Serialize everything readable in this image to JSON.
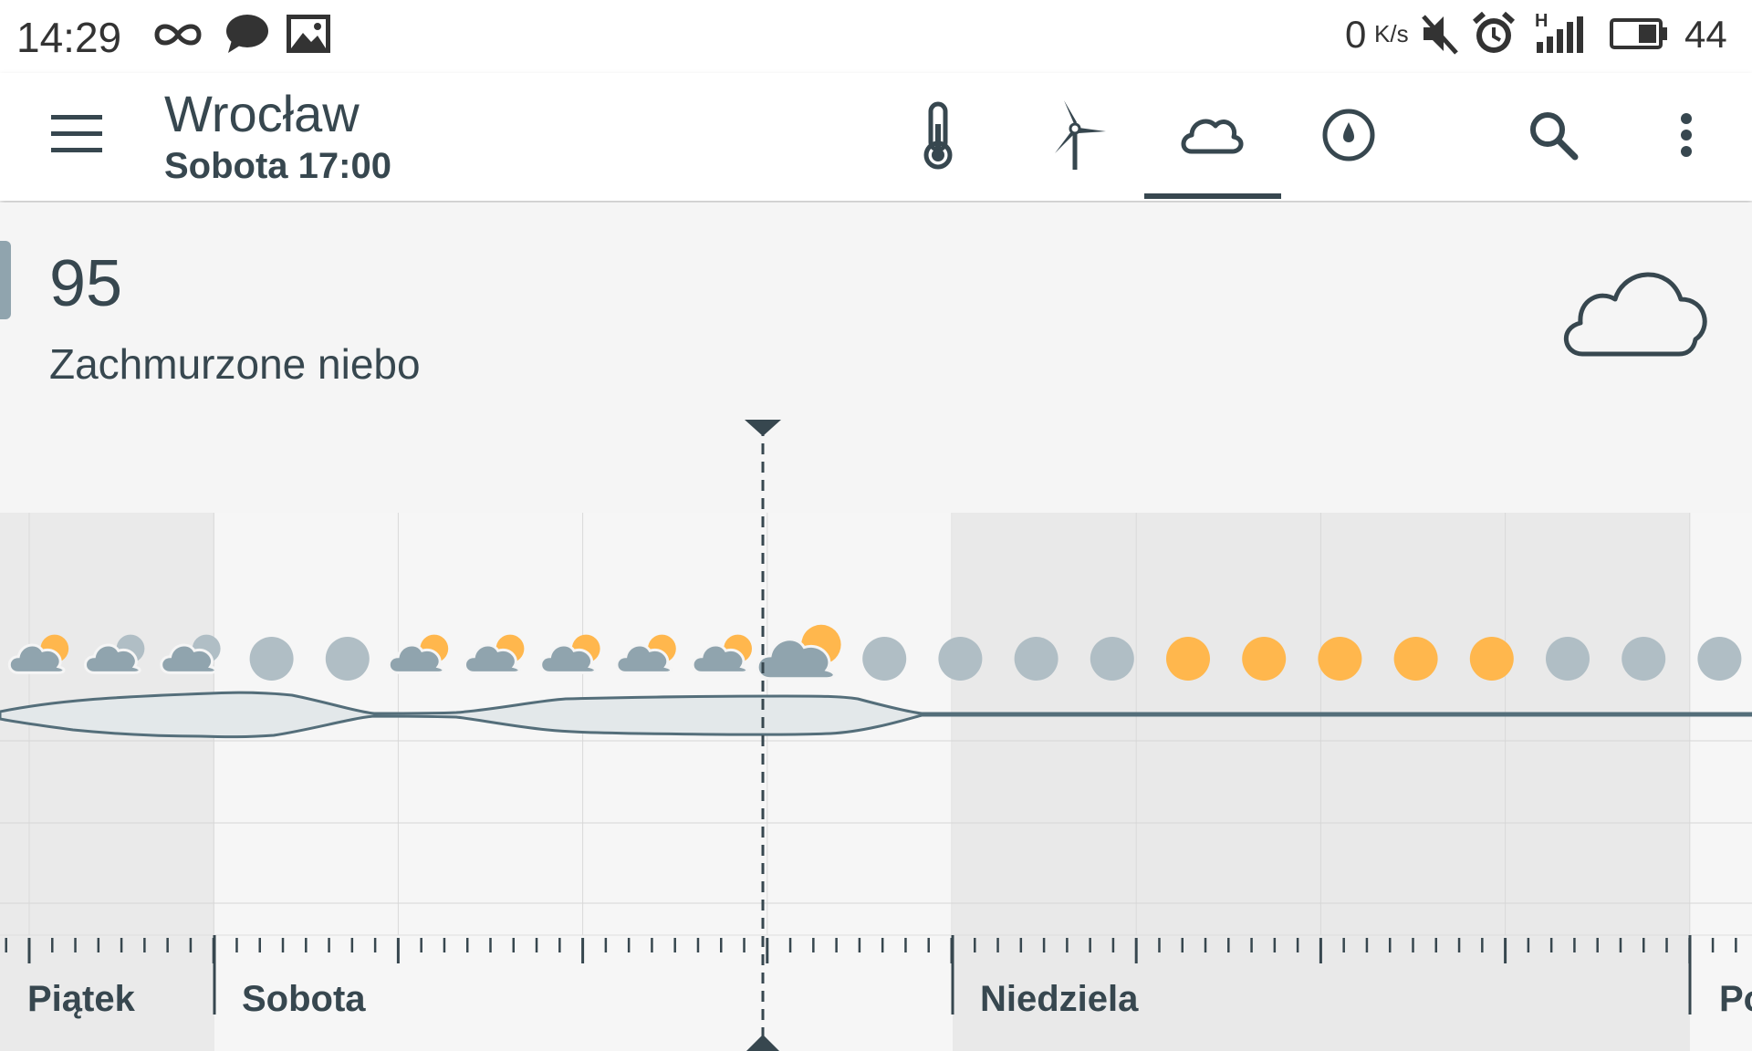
{
  "status_bar": {
    "time": "14:29",
    "speed": "0",
    "speed_unit": "K/s",
    "battery": "44",
    "network_badge": "H",
    "icons": [
      "infinity-icon",
      "chat-bubble-icon",
      "image-icon",
      "mute-icon",
      "alarm-icon",
      "signal-icon",
      "battery-icon"
    ]
  },
  "toolbar": {
    "city": "Wrocław",
    "datetime": "Sobota 17:00",
    "tabs": [
      {
        "icon": "thermometer-icon",
        "active": false
      },
      {
        "icon": "wind-turbine-icon",
        "active": false
      },
      {
        "icon": "cloud-icon",
        "active": true
      },
      {
        "icon": "pressure-gauge-icon",
        "active": false
      }
    ],
    "actions": [
      "search-icon",
      "more-vert-icon"
    ]
  },
  "current": {
    "value": "95",
    "description": "Zachmurzone niebo",
    "icon": "cloud-icon"
  },
  "timeline": {
    "days": [
      "Piątek",
      "Sobota",
      "Niedziela",
      "Po"
    ],
    "hourly_conditions": [
      "partly-cloudy",
      "partly-cloudy-grey",
      "partly-cloudy-grey",
      "cloudy",
      "cloudy",
      "partly-cloudy",
      "partly-cloudy",
      "partly-cloudy",
      "partly-cloudy",
      "partly-cloudy",
      "partly-cloudy-selected",
      "cloudy",
      "cloudy",
      "cloudy",
      "cloudy",
      "clear",
      "clear",
      "clear",
      "clear",
      "clear",
      "cloudy",
      "cloudy",
      "cloudy"
    ],
    "colors": {
      "sun": "#ffb74d",
      "cloud": "#90a4ae",
      "cloud_light": "#b0bec5",
      "line": "#546e7a"
    }
  }
}
